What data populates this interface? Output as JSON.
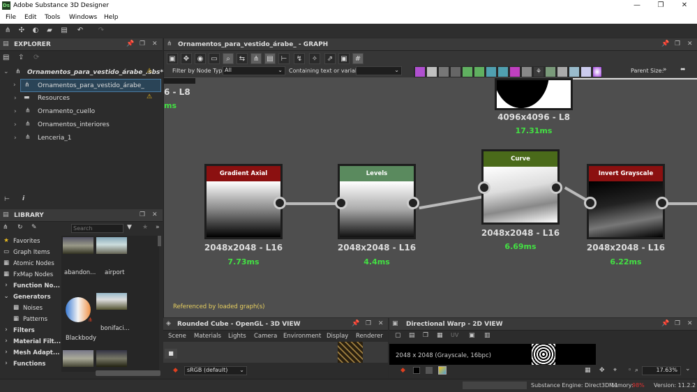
{
  "app": {
    "title": "Adobe Substance 3D Designer",
    "logo": "Ds"
  },
  "menu": [
    "File",
    "Edit",
    "Tools",
    "Windows",
    "Help"
  ],
  "explorer": {
    "title": "EXPLORER",
    "package": "Ornamentos_para_vestido_árabe_.sbs*",
    "items": [
      {
        "label": "Ornamentos_para_vestido_árabe_",
        "icon": "graph-icon",
        "selected": true
      },
      {
        "label": "Resources",
        "icon": "folder-icon",
        "warn": true
      },
      {
        "label": "Ornamento_cuello",
        "icon": "graph-icon"
      },
      {
        "label": "Ornamentos_interiores",
        "icon": "graph-icon"
      },
      {
        "label": "Lenceria_1",
        "icon": "graph-icon"
      }
    ]
  },
  "library": {
    "title": "LIBRARY",
    "search_placeholder": "Search",
    "categories": [
      {
        "label": "Favorites",
        "icon": "star-icon"
      },
      {
        "label": "Graph Items"
      },
      {
        "label": "Atomic Nodes"
      },
      {
        "label": "FxMap Nodes"
      },
      {
        "label": "Function No...",
        "bold": true
      },
      {
        "label": "Generators",
        "bold": true
      },
      {
        "label": "Noises",
        "sub": true
      },
      {
        "label": "Patterns",
        "sub": true
      },
      {
        "label": "Filters",
        "bold": true
      },
      {
        "label": "Material Filt...",
        "bold": true
      },
      {
        "label": "Mesh Adapt...",
        "bold": true
      },
      {
        "label": "Functions",
        "bold": true
      }
    ],
    "thumbs": [
      "abandon...",
      "airport",
      "Blackbody",
      "bonifaci..."
    ]
  },
  "graph": {
    "title": "Ornamentos_para_vestido_árabe_ - GRAPH",
    "filter_label": "Filter by Node Type",
    "filter_value": "All",
    "containing_label": "Containing text or variable",
    "parent_size": "Parent Size:",
    "footer": "Referenced by loaded graph(s)",
    "partial_left": {
      "res": "6 - L8",
      "ms": "ms"
    },
    "top_node": {
      "res": "4096x4096 - L8",
      "ms": "17.31ms"
    },
    "nodes": [
      {
        "name": "Gradient Axial",
        "res": "2048x2048 - L16",
        "ms": "7.73ms",
        "color": "#8b1010"
      },
      {
        "name": "Levels",
        "res": "2048x2048 - L16",
        "ms": "4.4ms",
        "color": "#5a8a5e"
      },
      {
        "name": "Curve",
        "res": "2048x2048 - L16",
        "ms": "6.69ms",
        "color": "#4a6a1a"
      },
      {
        "name": "Invert Grayscale",
        "res": "2048x2048 - L16",
        "ms": "6.22ms",
        "color": "#8b1010"
      }
    ]
  },
  "view3d": {
    "title": "Rounded Cube - OpenGL - 3D VIEW",
    "menus": [
      "Scene",
      "Materials",
      "Lights",
      "Camera",
      "Environment",
      "Display",
      "Renderer"
    ],
    "colorspace": "sRGB (default)"
  },
  "view2d": {
    "title": "Directional Warp - 2D VIEW",
    "info": "2048 x 2048 (Grayscale, 16bpc)",
    "uv": "UV",
    "zoom": "17.63%"
  },
  "status": {
    "engine": "Substance Engine: Direct3D 11",
    "memory_label": "Memory:",
    "memory": "98%",
    "version": "Version: 11.2.2"
  }
}
